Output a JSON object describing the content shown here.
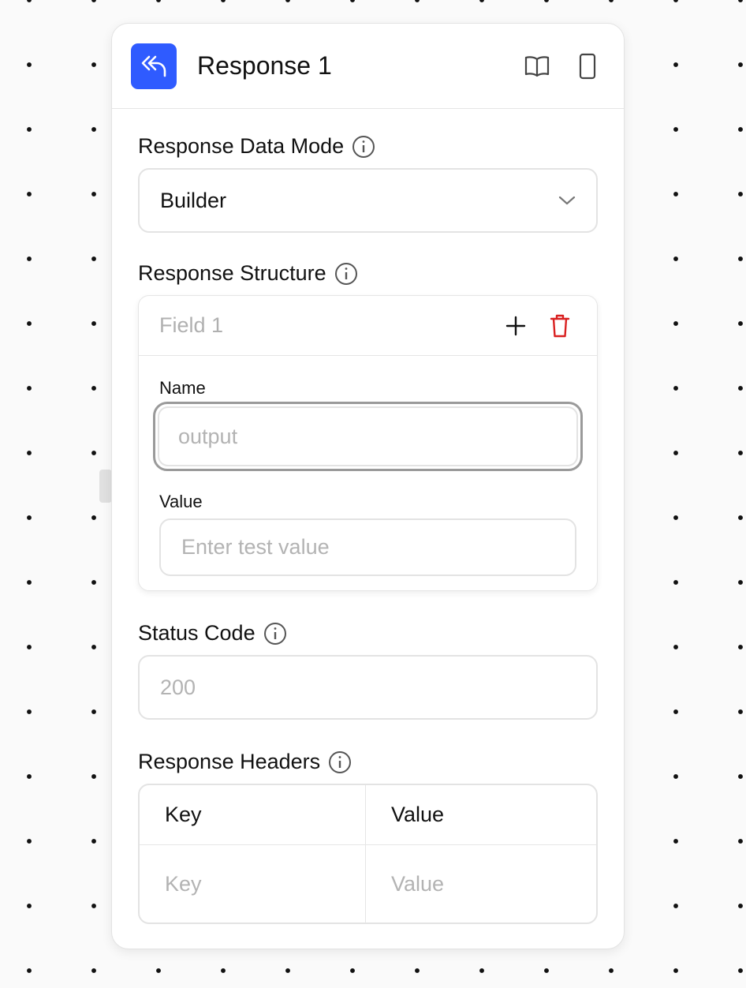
{
  "node": {
    "title": "Response 1",
    "icon": "reply-all-icon",
    "accent": "#2f5bff",
    "actions": [
      {
        "name": "docs-book-icon"
      },
      {
        "name": "mobile-device-icon"
      }
    ]
  },
  "response_data_mode": {
    "label": "Response Data Mode",
    "value": "Builder"
  },
  "response_structure": {
    "label": "Response Structure",
    "field": {
      "title": "Field 1",
      "name_label": "Name",
      "name_placeholder": "output",
      "value_label": "Value",
      "value_placeholder": "Enter test value"
    },
    "delete_color": "#d92020"
  },
  "status_code": {
    "label": "Status Code",
    "placeholder": "200"
  },
  "response_headers": {
    "label": "Response Headers",
    "columns": [
      "Key",
      "Value"
    ],
    "row_placeholders": [
      "Key",
      "Value"
    ]
  }
}
